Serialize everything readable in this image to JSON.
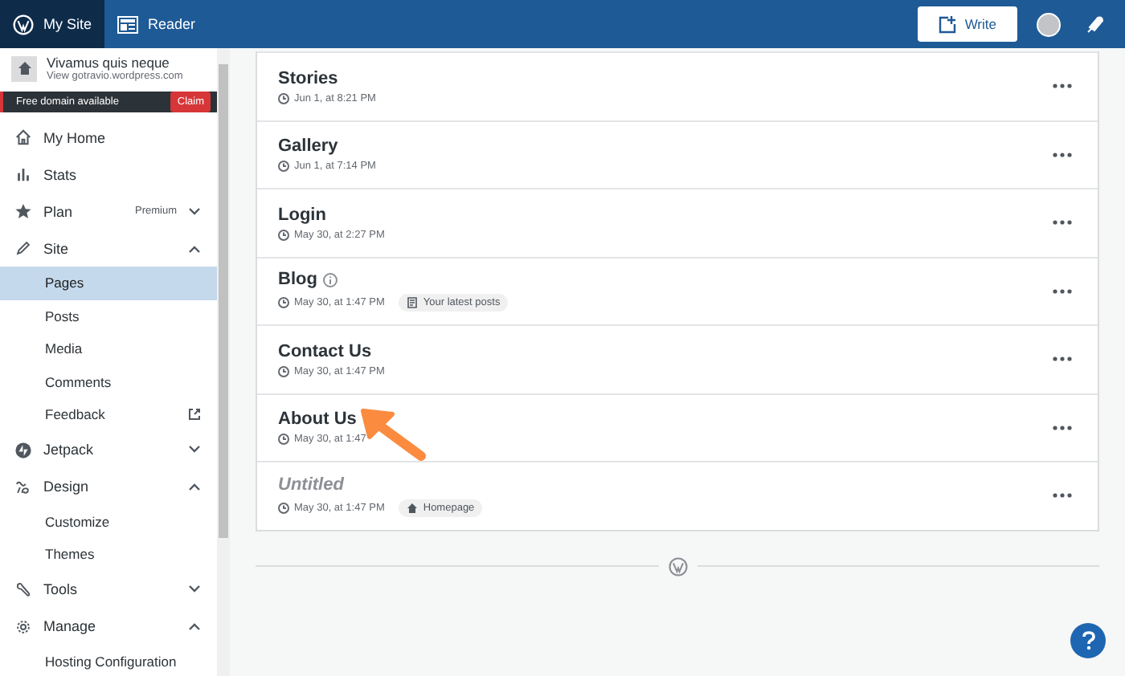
{
  "top_bar": {
    "my_site": "My Site",
    "reader": "Reader",
    "write": "Write"
  },
  "site": {
    "name": "Vivamus quis neque",
    "url": "View gotravio.wordpress.com"
  },
  "domain_banner": {
    "text": "Free domain available",
    "button": "Claim"
  },
  "menu": [
    {
      "kind": "main",
      "label": "My Home"
    },
    {
      "kind": "main",
      "label": "Stats"
    },
    {
      "kind": "main",
      "label": "Plan",
      "badge": "Premium",
      "expanded": false
    },
    {
      "kind": "main",
      "label": "Site",
      "expanded": true
    },
    {
      "kind": "sub",
      "label": "Pages",
      "selected": true
    },
    {
      "kind": "sub",
      "label": "Posts",
      "selected": false
    },
    {
      "kind": "sub",
      "label": "Media",
      "selected": false
    },
    {
      "kind": "sub",
      "label": "Comments",
      "selected": false
    },
    {
      "kind": "sub",
      "label": "Feedback",
      "selected": false,
      "external": true
    },
    {
      "kind": "main",
      "label": "Jetpack",
      "expanded": false
    },
    {
      "kind": "main",
      "label": "Design",
      "expanded": true
    },
    {
      "kind": "sub",
      "label": "Customize",
      "selected": false
    },
    {
      "kind": "sub",
      "label": "Themes",
      "selected": false
    },
    {
      "kind": "main",
      "label": "Tools",
      "expanded": false
    },
    {
      "kind": "main",
      "label": "Manage",
      "expanded": true
    },
    {
      "kind": "sub",
      "label": "Hosting Configuration",
      "selected": false
    }
  ],
  "pages": [
    {
      "kind": "page",
      "title": "Stories",
      "date": "Jun 1, at 8:21 PM"
    },
    {
      "kind": "page",
      "title": "Gallery",
      "date": "Jun 1, at 7:14 PM"
    },
    {
      "kind": "page",
      "title": "Login",
      "date": "May 30, at 2:27 PM"
    },
    {
      "kind": "page",
      "title": "Blog",
      "date": "May 30, at 1:47 PM",
      "info": true,
      "tag": {
        "kind": "posts",
        "label": "Your latest posts"
      }
    },
    {
      "kind": "page",
      "title": "Contact Us",
      "date": "May 30, at 1:47 PM"
    },
    {
      "kind": "page",
      "title": "About Us",
      "date": "May 30, at 1:47"
    },
    {
      "kind": "untitled",
      "title": "Untitled",
      "date": "May 30, at 1:47 PM",
      "tag": {
        "kind": "home",
        "label": "Homepage"
      }
    }
  ]
}
